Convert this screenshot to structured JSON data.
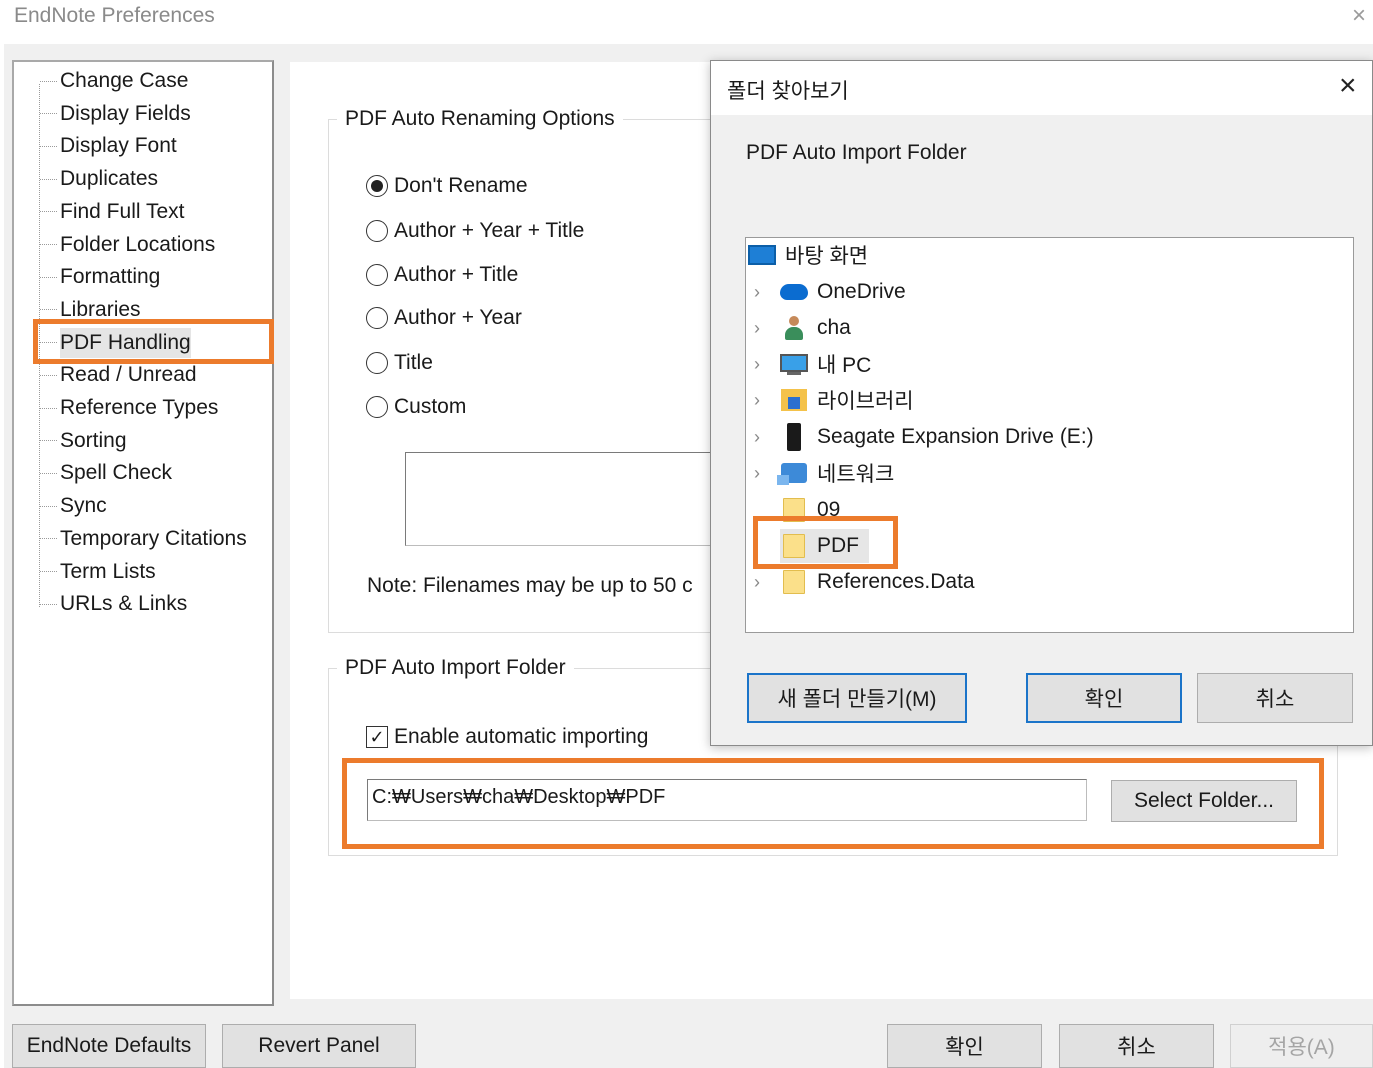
{
  "window": {
    "title": "EndNote Preferences",
    "close_glyph": "×"
  },
  "sidebar": {
    "items": [
      {
        "label": "Change Case"
      },
      {
        "label": "Display Fields"
      },
      {
        "label": "Display Font"
      },
      {
        "label": "Duplicates"
      },
      {
        "label": "Find Full Text"
      },
      {
        "label": "Folder Locations"
      },
      {
        "label": "Formatting"
      },
      {
        "label": "Libraries"
      },
      {
        "label": "PDF Handling",
        "selected": true
      },
      {
        "label": "Read / Unread"
      },
      {
        "label": "Reference Types"
      },
      {
        "label": "Sorting"
      },
      {
        "label": "Spell Check"
      },
      {
        "label": "Sync"
      },
      {
        "label": "Temporary Citations"
      },
      {
        "label": "Term Lists"
      },
      {
        "label": "URLs & Links"
      }
    ]
  },
  "renaming": {
    "title": "PDF Auto Renaming Options",
    "options": [
      {
        "label": "Don't Rename",
        "checked": true
      },
      {
        "label": "Author + Year + Title",
        "checked": false
      },
      {
        "label": "Author + Title",
        "checked": false
      },
      {
        "label": "Author + Year",
        "checked": false
      },
      {
        "label": "Title",
        "checked": false
      },
      {
        "label": "Custom",
        "checked": false
      }
    ],
    "note": "Note: Filenames may be up to 50 c"
  },
  "import": {
    "title": "PDF Auto Import Folder",
    "enable_label": "Enable automatic importing",
    "enable_checked": true,
    "check_glyph": "✓",
    "path": "C:₩Users₩cha₩Desktop₩PDF",
    "select_button": "Select Folder..."
  },
  "bottom": {
    "defaults": "EndNote Defaults",
    "revert": "Revert Panel",
    "ok": "확인",
    "cancel": "취소",
    "apply": "적용(A)"
  },
  "dialog": {
    "title": "폴더 찾아보기",
    "close_glyph": "×",
    "description": "PDF Auto Import Folder",
    "chevron_glyph": "›",
    "tree": [
      {
        "label": "바탕 화면",
        "icon": "desktop-icon"
      },
      {
        "label": "OneDrive",
        "icon": "onedrive-icon"
      },
      {
        "label": "cha",
        "icon": "user-folder-icon"
      },
      {
        "label": "내 PC",
        "icon": "pc-icon"
      },
      {
        "label": "라이브러리",
        "icon": "library-icon"
      },
      {
        "label": "Seagate Expansion Drive (E:)",
        "icon": "drive-icon"
      },
      {
        "label": "네트워크",
        "icon": "network-icon"
      },
      {
        "label": "09",
        "icon": "folder-icon"
      },
      {
        "label": "PDF",
        "icon": "folder-icon",
        "selected": true
      },
      {
        "label": "References.Data",
        "icon": "folder-icon"
      }
    ],
    "new_folder": "새 폴더 만들기(M)",
    "ok": "확인",
    "cancel": "취소"
  },
  "colors": {
    "highlight": "#ec7b2c",
    "focus_border": "#1b74c9"
  }
}
